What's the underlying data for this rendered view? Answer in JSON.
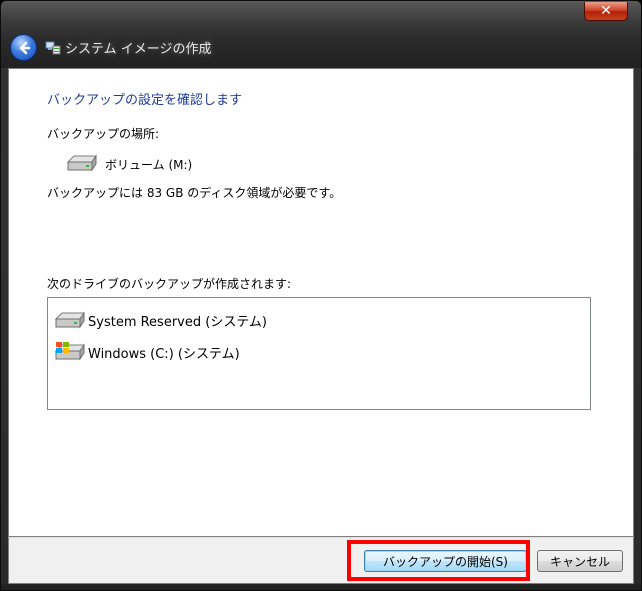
{
  "window": {
    "title": "システム イメージの作成",
    "close_glyph": "✕"
  },
  "content": {
    "heading": "バックアップの設定を確認します",
    "location_label": "バックアップの場所:",
    "location_value": "ボリューム (M:)",
    "space_required": "バックアップには 83 GB のディスク領域が必要です。",
    "drives_label": "次のドライブのバックアップが作成されます:",
    "drives": [
      {
        "name": "System Reserved (システム)",
        "icon": "hard-drive-icon"
      },
      {
        "name": "Windows (C:) (システム)",
        "icon": "windows-drive-icon"
      }
    ]
  },
  "footer": {
    "start_button": "バックアップの開始(S)",
    "cancel_button": "キャンセル"
  },
  "colors": {
    "heading": "#1e3f9a",
    "highlight": "#ff0000"
  }
}
